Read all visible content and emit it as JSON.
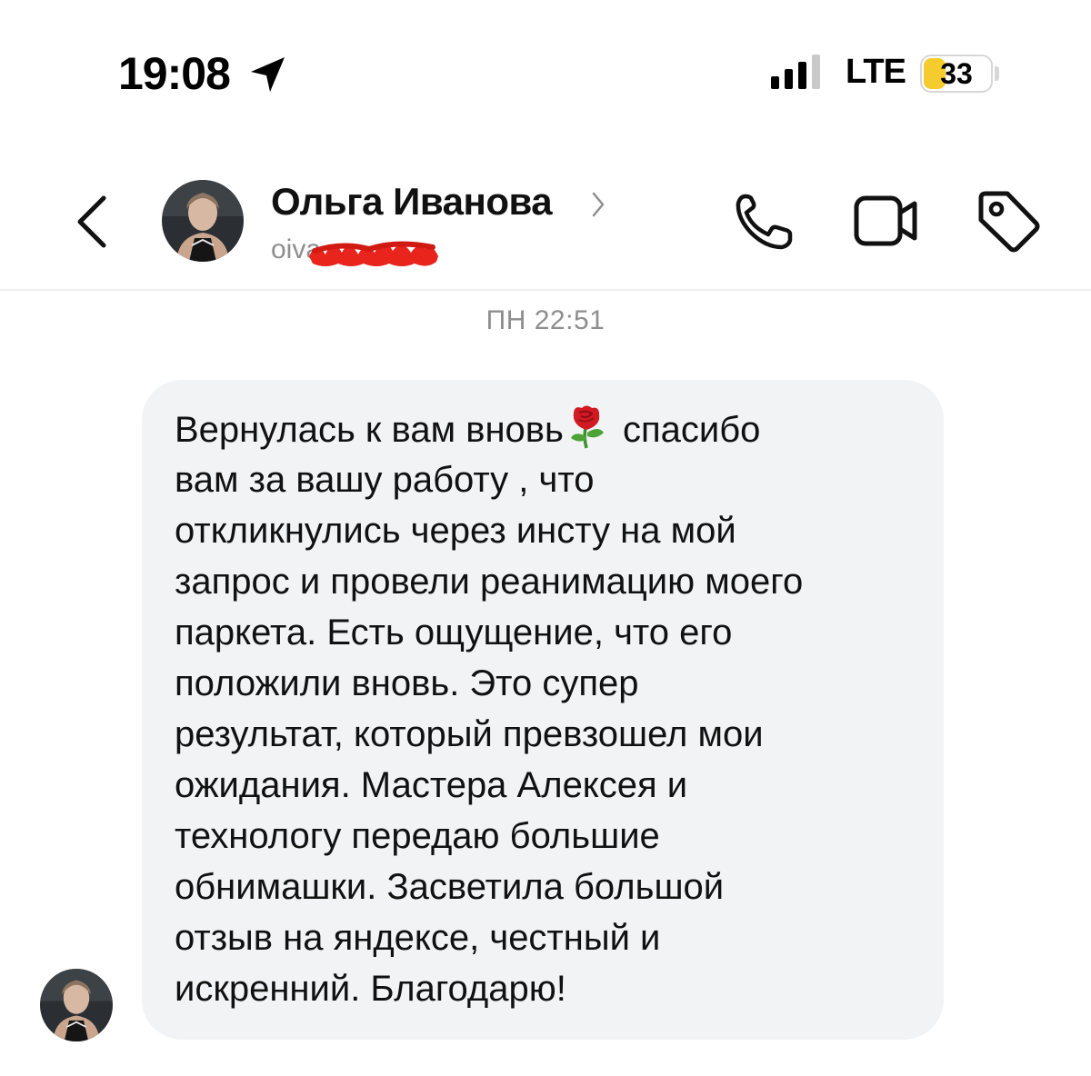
{
  "status_bar": {
    "time": "19:08",
    "network": "LTE",
    "battery": "33",
    "battery_level": 0.33,
    "icons": [
      "location-arrow-icon",
      "signal-icon",
      "battery-icon"
    ]
  },
  "header": {
    "contact_name": "Ольга Иванова",
    "handle_visible": "oiva",
    "icons": [
      "back-chevron-icon",
      "chevron-right-icon",
      "phone-icon",
      "video-camera-icon",
      "tag-icon"
    ]
  },
  "conversation": {
    "timestamp": "ПН 22:51",
    "message": {
      "lines": [
        {
          "before": "Вернулась к вам вновь",
          "emoji": "rose",
          "after": " спасибо"
        },
        {
          "text": "вам за вашу работу , что"
        },
        {
          "text": "откликнулись через инсту на мой"
        },
        {
          "text": "запрос и провели реанимацию моего"
        },
        {
          "text": "паркета. Есть ощущение, что его"
        },
        {
          "text": "положили вновь. Это супер"
        },
        {
          "text": "результат, который превзошел мои"
        },
        {
          "text": "ожидания. Мастера Алексея и"
        },
        {
          "text": "технологу передаю большие"
        },
        {
          "text": "обнимашки. Засветила большой"
        },
        {
          "text": "отзыв на яндексе, честный и"
        },
        {
          "text": "искренний. Благодарю!"
        }
      ]
    }
  },
  "colors": {
    "bubble": "#f2f3f5",
    "battery_fill": "#f5cc2e",
    "secondary_text": "#8e8e8e",
    "redaction": "#e8241c"
  }
}
